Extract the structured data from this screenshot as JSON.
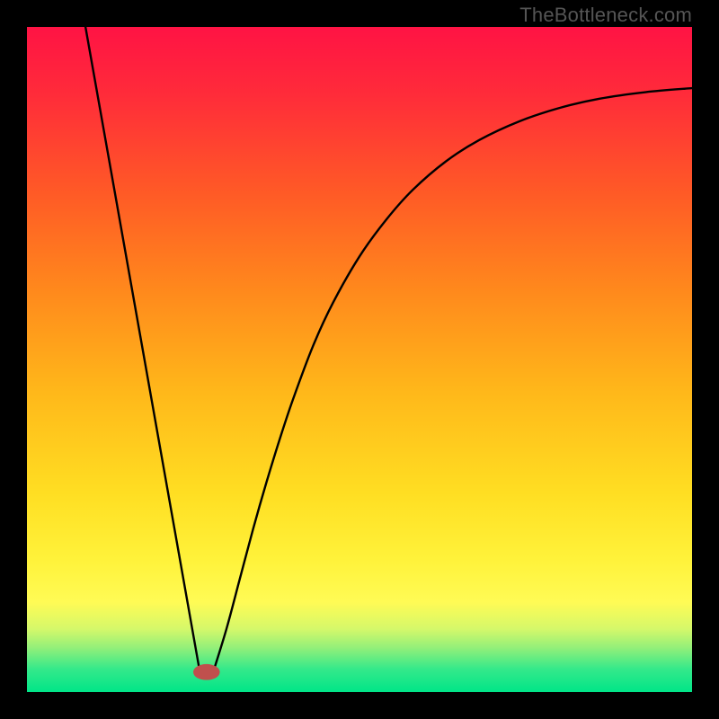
{
  "watermark": "TheBottleneck.com",
  "chart_data": {
    "type": "line",
    "title": "",
    "xlabel": "",
    "ylabel": "",
    "xlim": [
      0,
      1
    ],
    "ylim": [
      0,
      1
    ],
    "gradient_stops": [
      {
        "offset": 0.0,
        "color": "#ff1344"
      },
      {
        "offset": 0.1,
        "color": "#ff2b3a"
      },
      {
        "offset": 0.25,
        "color": "#ff5a26"
      },
      {
        "offset": 0.4,
        "color": "#ff8a1c"
      },
      {
        "offset": 0.55,
        "color": "#ffb81a"
      },
      {
        "offset": 0.7,
        "color": "#ffde22"
      },
      {
        "offset": 0.8,
        "color": "#fff23a"
      },
      {
        "offset": 0.865,
        "color": "#fffb55"
      },
      {
        "offset": 0.905,
        "color": "#d5f86a"
      },
      {
        "offset": 0.935,
        "color": "#8fef7a"
      },
      {
        "offset": 0.965,
        "color": "#35e98a"
      },
      {
        "offset": 1.0,
        "color": "#00e588"
      }
    ],
    "series": [
      {
        "name": "left-line",
        "x": [
          0.088,
          0.26
        ],
        "values": [
          1.0,
          0.03
        ]
      },
      {
        "name": "right-curve",
        "x": [
          0.28,
          0.3,
          0.32,
          0.34,
          0.36,
          0.38,
          0.4,
          0.43,
          0.46,
          0.5,
          0.54,
          0.58,
          0.63,
          0.68,
          0.74,
          0.8,
          0.86,
          0.93,
          1.0
        ],
        "values": [
          0.03,
          0.095,
          0.17,
          0.245,
          0.315,
          0.38,
          0.44,
          0.52,
          0.585,
          0.655,
          0.71,
          0.755,
          0.798,
          0.83,
          0.858,
          0.878,
          0.892,
          0.902,
          0.908
        ]
      }
    ],
    "marker": {
      "name": "red-pill",
      "cx": 0.27,
      "cy": 0.03,
      "rx": 0.02,
      "ry": 0.012,
      "fill": "#c0504d"
    }
  }
}
